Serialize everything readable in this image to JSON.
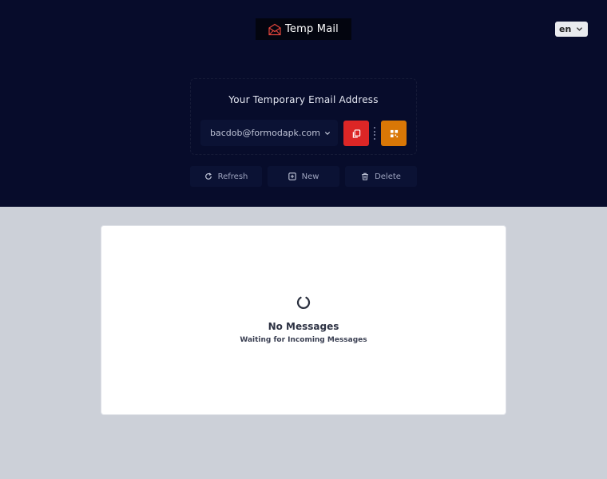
{
  "header": {
    "logo_text": "Temp Mail",
    "language": "en"
  },
  "email_box": {
    "title": "Your Temporary Email Address",
    "address": "bacdob@formodapk.com"
  },
  "actions": {
    "refresh": "Refresh",
    "new": "New",
    "delete": "Delete"
  },
  "inbox": {
    "status": "No Messages",
    "subtitle": "Waiting for Incoming Messages"
  },
  "colors": {
    "hero_bg": "#070c2b",
    "copy_button": "#dc2626",
    "qr_button": "#d97706",
    "page_bg": "#ccd0d8"
  },
  "icons": {
    "logo": "envelope-icon",
    "copy": "copy-icon",
    "qr": "qr-code-icon",
    "refresh": "refresh-icon",
    "new": "plus-square-icon",
    "delete": "trash-icon",
    "loading": "spinner-icon"
  }
}
